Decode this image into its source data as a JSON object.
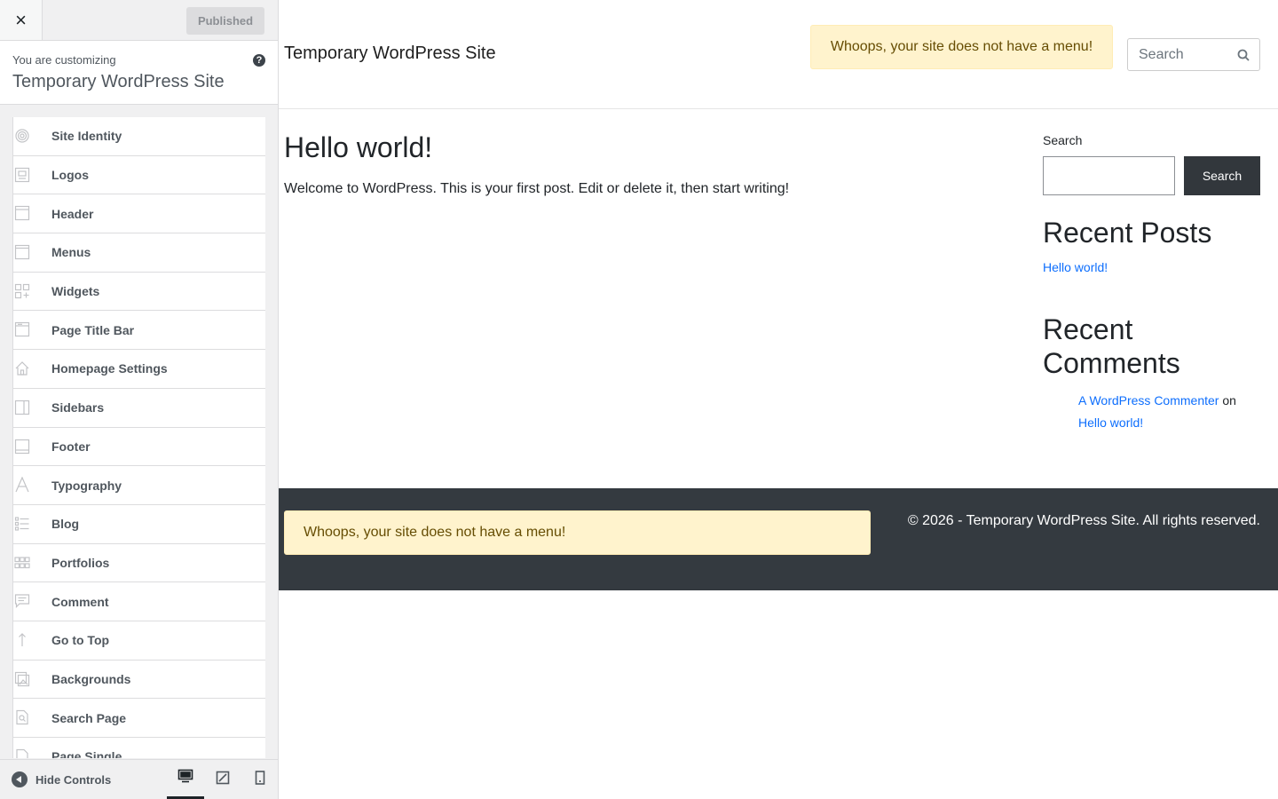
{
  "customizer": {
    "close_label": "×",
    "publish_label": "Published",
    "info": {
      "customizing_label": "You are customizing",
      "site_name": "Temporary WordPress Site",
      "help_label": "?"
    },
    "panels": [
      {
        "label": "Site Identity",
        "icon": "fingerprint-icon"
      },
      {
        "label": "Logos",
        "icon": "image-icon"
      },
      {
        "label": "Header",
        "icon": "header-layout-icon"
      },
      {
        "label": "Menus",
        "icon": "menu-layout-icon"
      },
      {
        "label": "Widgets",
        "icon": "widgets-icon"
      },
      {
        "label": "Page Title Bar",
        "icon": "title-bar-icon"
      },
      {
        "label": "Homepage Settings",
        "icon": "home-icon"
      },
      {
        "label": "Sidebars",
        "icon": "sidebar-layout-icon"
      },
      {
        "label": "Footer",
        "icon": "footer-layout-icon"
      },
      {
        "label": "Typography",
        "icon": "typography-icon"
      },
      {
        "label": "Blog",
        "icon": "blog-list-icon"
      },
      {
        "label": "Portfolios",
        "icon": "portfolio-grid-icon"
      },
      {
        "label": "Comment",
        "icon": "comment-icon"
      },
      {
        "label": "Go to Top",
        "icon": "arrow-up-icon"
      },
      {
        "label": "Backgrounds",
        "icon": "backgrounds-icon"
      },
      {
        "label": "Search Page",
        "icon": "search-page-icon"
      },
      {
        "label": "Page Single",
        "icon": "page-icon"
      }
    ],
    "footer": {
      "hide_controls_label": "Hide Controls",
      "devices": [
        "desktop-icon",
        "tablet-icon",
        "mobile-icon"
      ],
      "active_device": "desktop"
    }
  },
  "preview": {
    "site_title": "Temporary WordPress Site",
    "menu_notice": "Whoops, your site does not have a menu!",
    "header_search_placeholder": "Search",
    "post": {
      "title": "Hello world!",
      "content": "Welcome to WordPress. This is your first post. Edit or delete it, then start writing!"
    },
    "sidebar": {
      "search_label": "Search",
      "search_button": "Search",
      "recent_posts_title": "Recent Posts",
      "recent_post": "Hello world!",
      "recent_comments_title": "Recent Comments",
      "comment_author": "A WordPress Commenter",
      "comment_on": "on",
      "comment_post": "Hello world!"
    },
    "footer": {
      "menu_notice": "Whoops, your site does not have a menu!",
      "copyright": "© 2026 - Temporary WordPress Site. All rights reserved."
    }
  }
}
